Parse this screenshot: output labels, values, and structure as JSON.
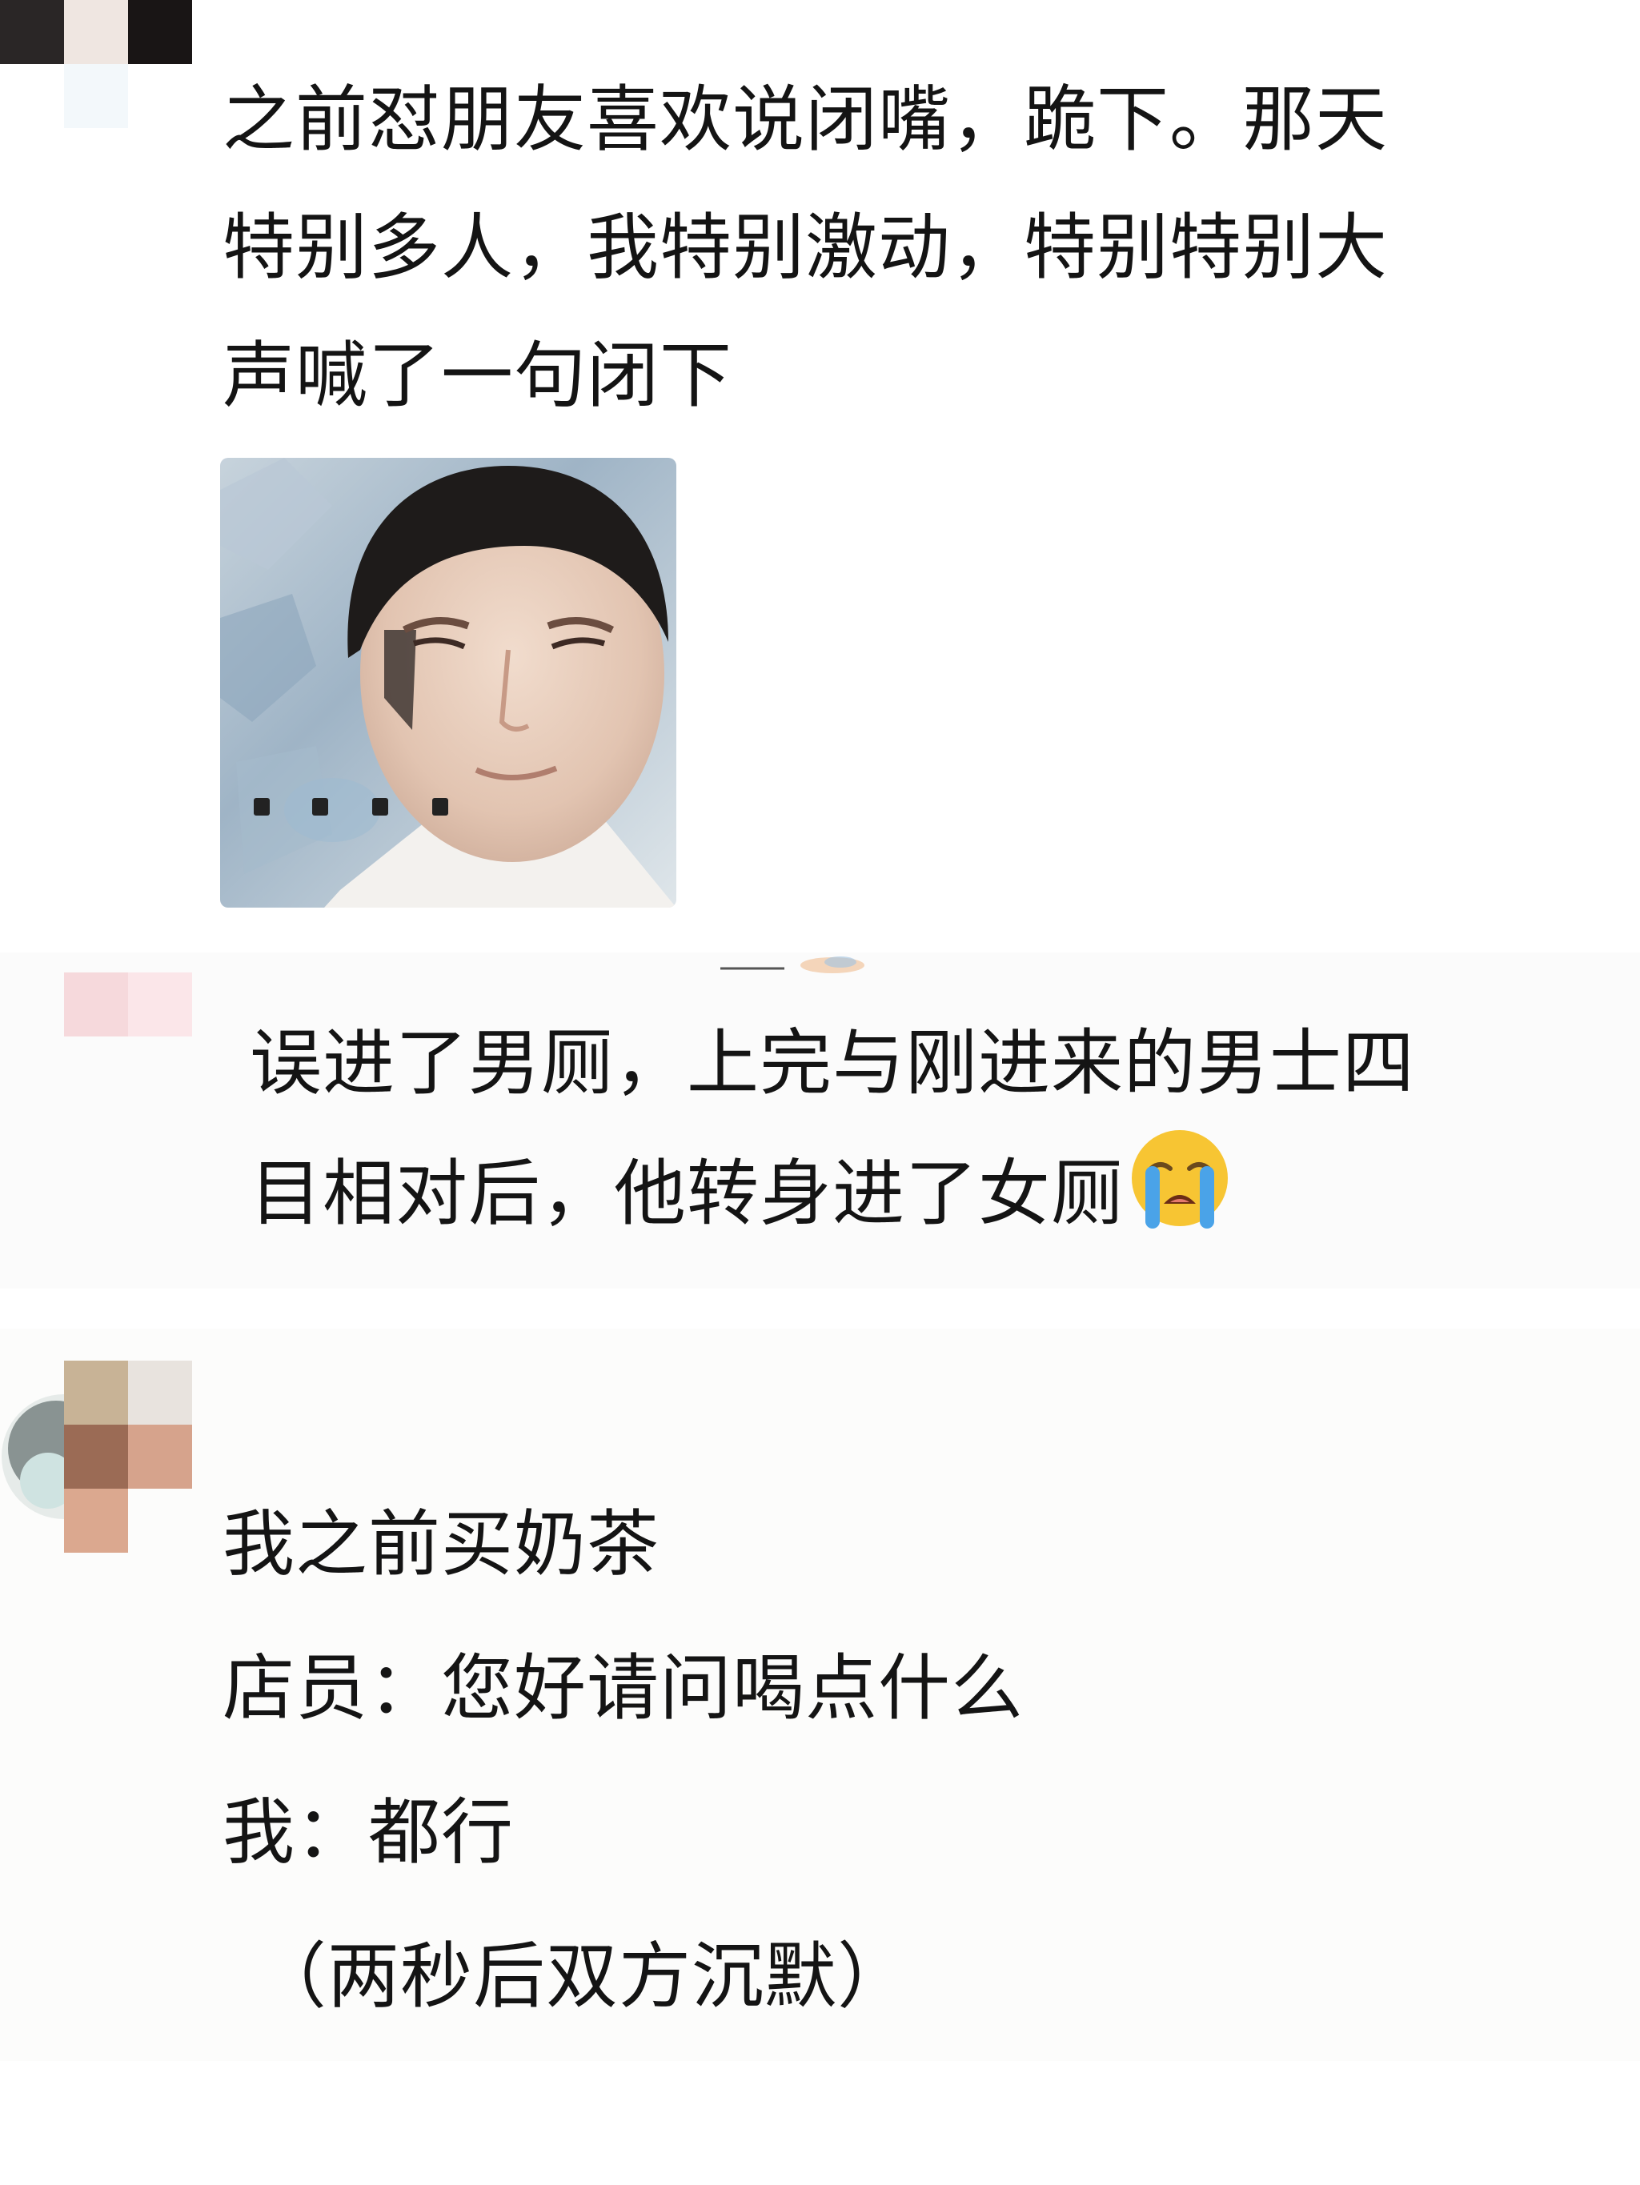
{
  "feed": {
    "comments": [
      {
        "text_lines": [
          "之前怼朋友喜欢说闭嘴，跪下。那天",
          "特别多人，我特别激动，特别特别大",
          "声喊了一句闭下"
        ],
        "attachment": {
          "type": "meme-photo",
          "caption": "....",
          "color": "#9fb4c6"
        }
      },
      {
        "text_lines": [
          "误进了男厕，上完与刚进来的男士四",
          "目相对后，他转身进了女厕"
        ],
        "emoji": "loudly-crying-face-emoji"
      },
      {
        "text_lines": [
          "我之前买奶茶",
          "店员：您好请问喝点什么",
          "我：都行",
          "（两秒后双方沉默）"
        ]
      }
    ]
  },
  "colors": {
    "text": "#141414",
    "emoji_face": "#f7c533",
    "emoji_tears": "#4aa3e8"
  }
}
